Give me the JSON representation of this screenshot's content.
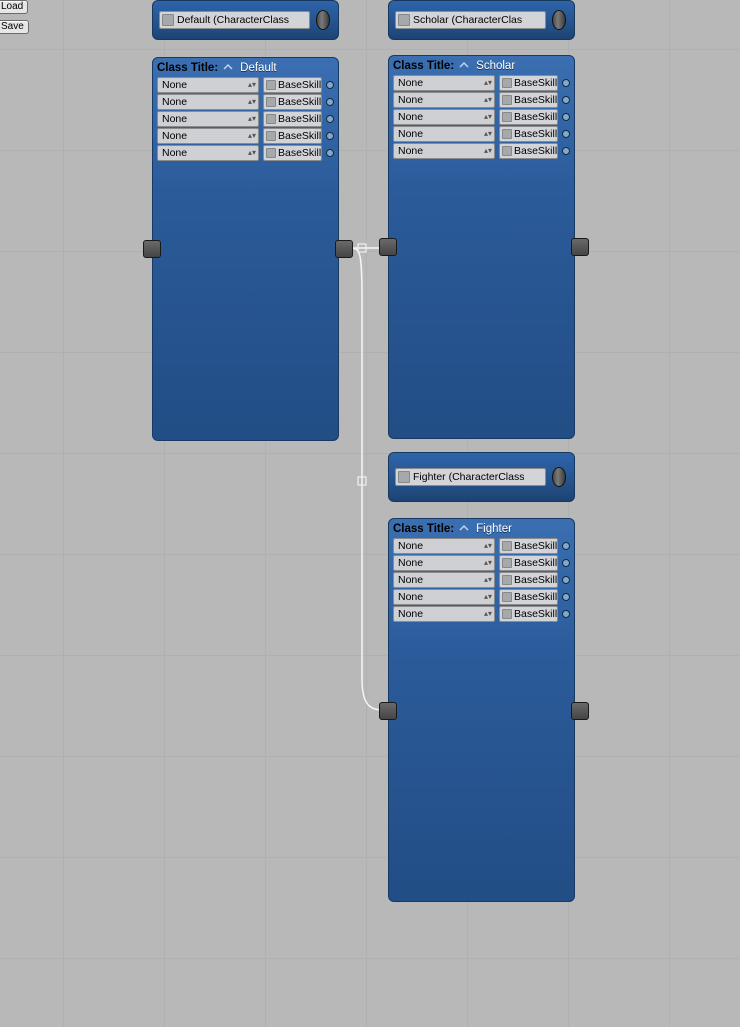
{
  "toolbar": {
    "load": "Load",
    "save": "Save"
  },
  "headers": {
    "default": {
      "ref": "Default (CharacterClass"
    },
    "scholar": {
      "ref": "Scholar (CharacterClas"
    },
    "fighter": {
      "ref": "Fighter (CharacterClass"
    }
  },
  "nodes": {
    "default": {
      "title_label": "Class Title:",
      "title_value": "Default",
      "rows": [
        {
          "enum": "None",
          "obj": "BaseSkillD"
        },
        {
          "enum": "None",
          "obj": "BaseSkillD"
        },
        {
          "enum": "None",
          "obj": "BaseSkillD"
        },
        {
          "enum": "None",
          "obj": "BaseSkillD"
        },
        {
          "enum": "None",
          "obj": "BaseSkillD"
        }
      ]
    },
    "scholar": {
      "title_label": "Class Title:",
      "title_value": "Scholar",
      "rows": [
        {
          "enum": "None",
          "obj": "BaseSkillD"
        },
        {
          "enum": "None",
          "obj": "BaseSkillD"
        },
        {
          "enum": "None",
          "obj": "BaseSkillD"
        },
        {
          "enum": "None",
          "obj": "BaseSkillD"
        },
        {
          "enum": "None",
          "obj": "BaseSkillD"
        }
      ]
    },
    "fighter": {
      "title_label": "Class Title:",
      "title_value": "Fighter",
      "rows": [
        {
          "enum": "None",
          "obj": "BaseSkillD"
        },
        {
          "enum": "None",
          "obj": "BaseSkillD"
        },
        {
          "enum": "None",
          "obj": "BaseSkillD"
        },
        {
          "enum": "None",
          "obj": "BaseSkillD"
        },
        {
          "enum": "None",
          "obj": "BaseSkillD"
        }
      ]
    }
  }
}
